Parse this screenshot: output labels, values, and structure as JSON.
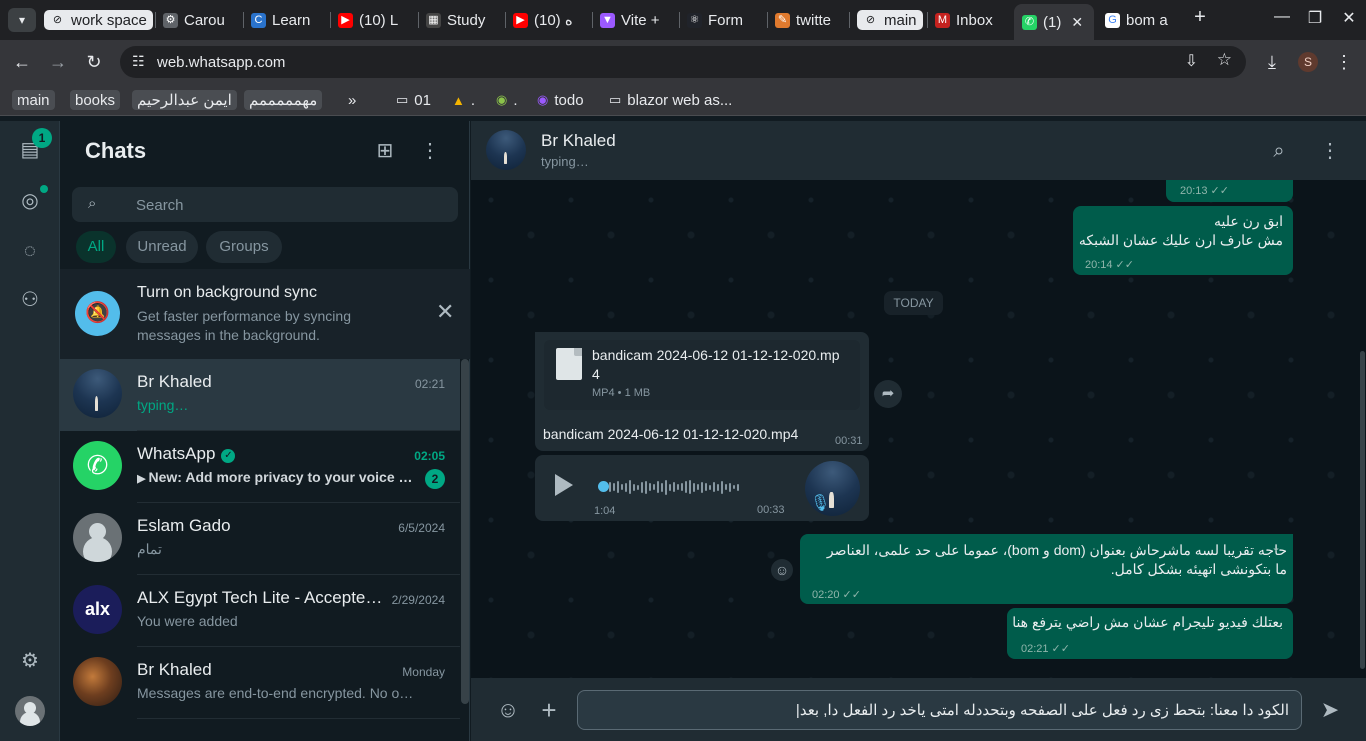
{
  "browser": {
    "tabs": [
      {
        "label": "work space",
        "kind": "group",
        "icon": "link-icon"
      },
      {
        "label": "Carou",
        "kind": "tab",
        "icon": "gear-icon"
      },
      {
        "label": "Learn",
        "kind": "tab",
        "icon": "coursera-icon"
      },
      {
        "label": "(10) L",
        "kind": "tab",
        "icon": "youtube-icon"
      },
      {
        "label": "Study",
        "kind": "tab",
        "icon": "study-icon"
      },
      {
        "label": "(10) ه",
        "kind": "tab",
        "icon": "youtube-icon"
      },
      {
        "label": "Vite +",
        "kind": "tab",
        "icon": "vite-icon"
      },
      {
        "label": "Form",
        "kind": "tab",
        "icon": "react-icon"
      },
      {
        "label": "twitte",
        "kind": "tab",
        "icon": "twitter-icon"
      },
      {
        "label": "main",
        "kind": "group",
        "icon": "link-icon"
      },
      {
        "label": "Inbox",
        "kind": "tab",
        "icon": "gmail-icon"
      },
      {
        "label": "(1)",
        "kind": "active",
        "icon": "whatsapp-icon"
      },
      {
        "label": "bom a",
        "kind": "tab",
        "icon": "google-icon"
      }
    ],
    "url": "web.whatsapp.com",
    "profile_initial": "S",
    "bookmarks": [
      {
        "label": "main",
        "kind": "chip"
      },
      {
        "label": "books",
        "kind": "chip"
      },
      {
        "label": "ايمن عبدالرحيم",
        "kind": "chip"
      },
      {
        "label": "مهمممممم",
        "kind": "chip"
      },
      {
        "label": "»",
        "kind": "text"
      },
      {
        "label": "01",
        "kind": "folder"
      },
      {
        "label": ".",
        "kind": "drive"
      },
      {
        "label": ".",
        "kind": "site"
      },
      {
        "label": "todo",
        "kind": "site"
      },
      {
        "label": "blazor web as...",
        "kind": "folder"
      }
    ]
  },
  "nav": {
    "chats_badge": "1"
  },
  "sidebar": {
    "title": "Chats",
    "search_placeholder": "Search",
    "filters": [
      "All",
      "Unread",
      "Groups"
    ],
    "sync_banner": {
      "title": "Turn on background sync",
      "text": "Get faster performance by syncing messages in the background."
    },
    "chats": [
      {
        "name": "Br Khaled",
        "time": "02:21",
        "last": "typing…",
        "avatar": "photo",
        "selected": true,
        "typing": true
      },
      {
        "name": "WhatsApp",
        "time": "02:05",
        "last": "New: Add more privacy to your voice notes",
        "avatar": "whatsapp",
        "unread": "2",
        "verified": true
      },
      {
        "name": "Eslam Gado",
        "time": "6/5/2024",
        "last": "تمام",
        "avatar": "default"
      },
      {
        "name": "ALX Egypt Tech Lite - Accepted Learners",
        "time": "2/29/2024",
        "last": "You were added",
        "avatar": "alx"
      },
      {
        "name": "Br Khaled",
        "time": "Monday",
        "last": "Messages are end-to-end encrypted. No one outside of this chat can read them.",
        "avatar": "warm"
      }
    ]
  },
  "conversation": {
    "name": "Br Khaled",
    "status": "typing…",
    "messages": {
      "out1_time": "20:13",
      "out2_lines": [
        "ابق رن عليه",
        "مش عارف ارن عليك عشان الشبكه"
      ],
      "out2_time": "20:14",
      "day": "TODAY",
      "doc_name": "bandicam 2024-06-12 01-12-12-020.mp4",
      "doc_meta": "MP4 • 1 MB",
      "doc_caption": "bandicam 2024-06-12 01-12-12-020.mp4",
      "doc_time": "00:31",
      "voice_duration": "1:04",
      "voice_time": "00:33",
      "out3_text": "حاجه تقريبا لسه ماشرحاش بعنوان (dom و bom)، عموما على حد علمى، العناصر ما بتكونشى اتهيئه بشكل كامل.",
      "out3_time": "02:20",
      "out4_text": "بعتلك فيديو تليجرام عشان مش راضي يترفع هنا",
      "out4_time": "02:21"
    },
    "composer_text": "الكود دا  معنا: بتحط زى رد فعل على الصفحه وبتحددله امتى ياخد رد الفعل دا, بعد|"
  },
  "colors": {
    "accent": "#00a884",
    "outgoing_bubble": "#005c4b",
    "incoming_bubble": "#202c33",
    "panel": "#111b21"
  }
}
